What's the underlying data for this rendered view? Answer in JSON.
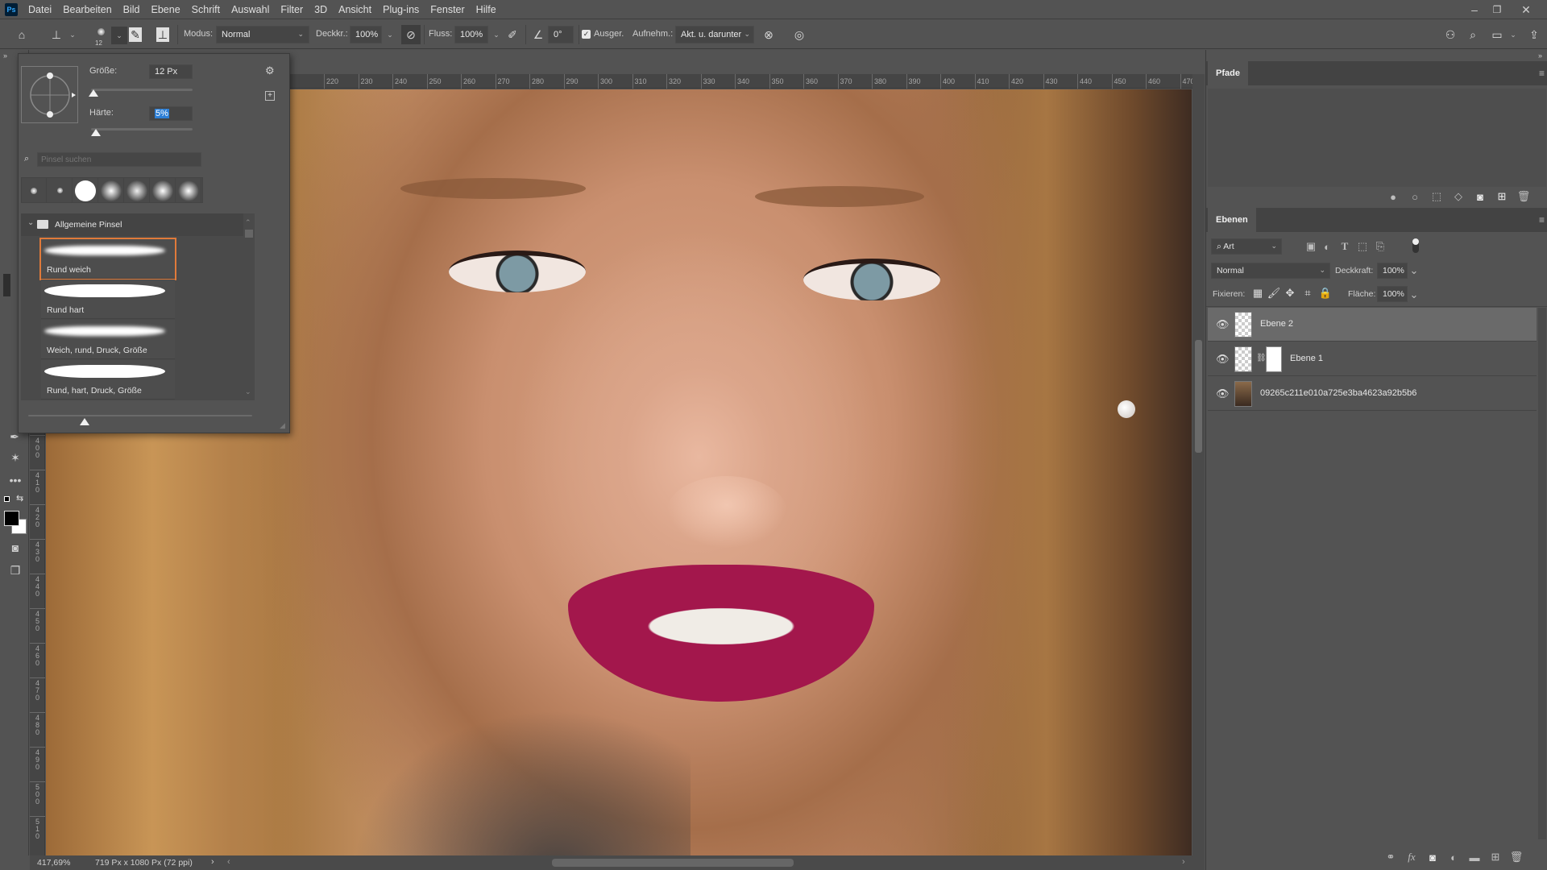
{
  "app": {
    "logo": "Ps"
  },
  "menubar": {
    "items": [
      "Datei",
      "Bearbeiten",
      "Bild",
      "Ebene",
      "Schrift",
      "Auswahl",
      "Filter",
      "3D",
      "Ansicht",
      "Plug-ins",
      "Fenster",
      "Hilfe"
    ],
    "window_controls": {
      "minimize": "–",
      "restore": "❐",
      "close": "✕"
    }
  },
  "options_bar": {
    "brush_size_badge": "12",
    "modus_label": "Modus:",
    "modus_value": "Normal",
    "deckkraft_label": "Deckkr.:",
    "deckkraft_value": "100%",
    "fluss_label": "Fluss:",
    "fluss_value": "100%",
    "angle_value": "0°",
    "ausger_label": "Ausger.",
    "ausger_checked": true,
    "aufnehm_label": "Aufnehm.:",
    "aufnehm_value": "Akt. u. darunter"
  },
  "brush_popup": {
    "size_label": "Größe:",
    "size_value": "12 Px",
    "size_slider_fraction": 0.02,
    "hardness_label": "Härte:",
    "hardness_value": "5%",
    "hardness_slider_fraction": 0.05,
    "search_placeholder": "Pinsel suchen",
    "recent_tips": 7,
    "group_label": "Allgemeine Pinsel",
    "brushes": [
      {
        "label": "Rund weich",
        "soft": true,
        "selected": true
      },
      {
        "label": "Rund hart",
        "soft": false,
        "selected": false
      },
      {
        "label": "Weich, rund, Druck, Größe",
        "soft": true,
        "selected": false
      },
      {
        "label": "Rund, hart, Druck, Größe",
        "soft": false,
        "selected": false
      }
    ],
    "preview_size_fraction": 0.25,
    "accent_color": "#e07a3a"
  },
  "rulers": {
    "horizontal": [
      "220",
      "230",
      "240",
      "250",
      "260",
      "270",
      "280",
      "290",
      "300",
      "310",
      "320",
      "330",
      "340",
      "350",
      "360",
      "370",
      "380",
      "390",
      "400",
      "410",
      "420",
      "430",
      "440",
      "450",
      "460",
      "470"
    ],
    "vertical": [
      "400",
      "410",
      "420",
      "430",
      "440",
      "450",
      "460",
      "470",
      "480",
      "490",
      "500",
      "510"
    ]
  },
  "status_bar": {
    "zoom": "417,69%",
    "doc_info": "719 Px x 1080 Px (72 ppi)"
  },
  "paths_panel": {
    "tab_label": "Pfade"
  },
  "layers_panel": {
    "tab_label": "Ebenen",
    "filter_label": "Art",
    "blend_mode": "Normal",
    "opacity_label": "Deckkraft:",
    "opacity_value": "100%",
    "lock_label": "Fixieren:",
    "fill_label": "Fläche:",
    "fill_value": "100%",
    "layers": [
      {
        "name": "Ebene 2",
        "visible": true,
        "selected": true
      },
      {
        "name": "Ebene 1",
        "visible": true,
        "selected": false,
        "has_mask": true
      },
      {
        "name": "09265c211e010a725e3ba4623a92b5b6",
        "visible": true,
        "selected": false
      }
    ]
  }
}
